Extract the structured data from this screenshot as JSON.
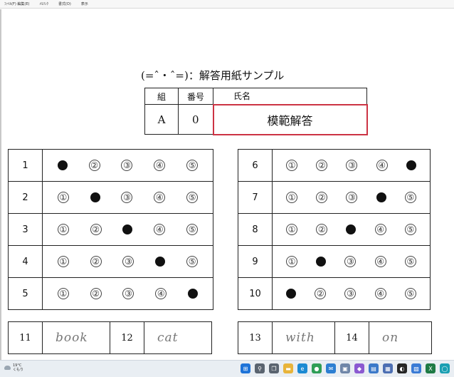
{
  "menubar": [
    "ﾌｧｲﾙ(F) 編集(E)",
    "ﾒﾓﾘﾝｸ",
    "書式(O)",
    "表示"
  ],
  "document": {
    "title": "(=ˆ・ˆ=)：解答用紙サンプル",
    "name_table": {
      "headers": [
        "組",
        "番号",
        "氏名"
      ],
      "values": [
        "A",
        "0",
        "模範解答"
      ]
    },
    "circled": [
      "①",
      "②",
      "③",
      "④",
      "⑤"
    ],
    "left_questions": [
      {
        "num": "1",
        "answer": 1
      },
      {
        "num": "2",
        "answer": 2
      },
      {
        "num": "3",
        "answer": 3
      },
      {
        "num": "4",
        "answer": 4
      },
      {
        "num": "5",
        "answer": 5
      }
    ],
    "right_questions": [
      {
        "num": "6",
        "answer": 5
      },
      {
        "num": "7",
        "answer": 4
      },
      {
        "num": "8",
        "answer": 3
      },
      {
        "num": "9",
        "answer": 2
      },
      {
        "num": "10",
        "answer": 1
      }
    ],
    "written": [
      {
        "num": "11",
        "text": "book"
      },
      {
        "num": "12",
        "text": "cat"
      },
      {
        "num": "13",
        "text": "with"
      },
      {
        "num": "14",
        "text": "on"
      }
    ]
  },
  "taskbar": {
    "weather_temp": "19°C",
    "weather_cond": "くもり",
    "icons": [
      {
        "name": "start-icon",
        "color": "#1e73d8",
        "glyph": "⊞"
      },
      {
        "name": "search-icon",
        "color": "#5a6470",
        "glyph": "⚲"
      },
      {
        "name": "task-view-icon",
        "color": "#5a6470",
        "glyph": "❐"
      },
      {
        "name": "file-explorer-icon",
        "color": "#e8b43a",
        "glyph": "▬"
      },
      {
        "name": "edge-icon",
        "color": "#1b8ad3",
        "glyph": "e"
      },
      {
        "name": "chrome-icon",
        "color": "#2f9e57",
        "glyph": "●"
      },
      {
        "name": "mail-icon",
        "color": "#2d7fd2",
        "glyph": "✉"
      },
      {
        "name": "photos-icon",
        "color": "#6f86a8",
        "glyph": "▣"
      },
      {
        "name": "visual-studio-icon",
        "color": "#8b5ad1",
        "glyph": "◆"
      },
      {
        "name": "notes-icon",
        "color": "#3b79c9",
        "glyph": "▤"
      },
      {
        "name": "calendar-icon",
        "color": "#4c6fb3",
        "glyph": "▦"
      },
      {
        "name": "app-icon",
        "color": "#262626",
        "glyph": "◐"
      },
      {
        "name": "store-icon",
        "color": "#3a7bd5",
        "glyph": "▧"
      },
      {
        "name": "excel-icon",
        "color": "#1f7a45",
        "glyph": "X"
      },
      {
        "name": "cortana-icon",
        "color": "#1a9fb2",
        "glyph": "◯"
      }
    ]
  }
}
